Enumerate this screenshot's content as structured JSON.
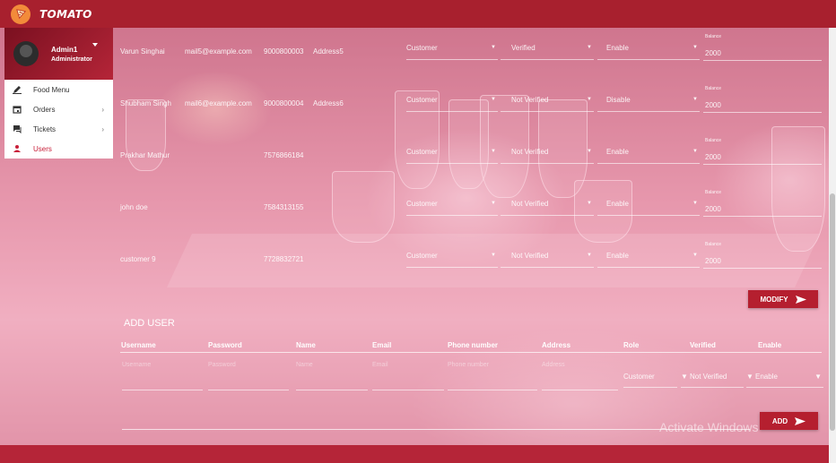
{
  "app": {
    "title": "TOMATO"
  },
  "profile": {
    "name": "Admin1",
    "role": "Administrator"
  },
  "menu": [
    {
      "label": "Food Menu",
      "icon": "pencil-icon",
      "has_chevron": false
    },
    {
      "label": "Orders",
      "icon": "calendar-icon",
      "has_chevron": true
    },
    {
      "label": "Tickets",
      "icon": "chat-icon",
      "has_chevron": true
    },
    {
      "label": "Users",
      "icon": "person-icon",
      "has_chevron": false
    }
  ],
  "users": [
    {
      "name": "Varun Singhai",
      "email": "mail5@example.com",
      "phone": "9000800003",
      "address": "Address5",
      "role": "Customer",
      "verified": "Verified",
      "enable": "Enable",
      "balance_label": "Balance",
      "balance": "2000"
    },
    {
      "name": "Shubham Singh",
      "email": "mail6@example.com",
      "phone": "9000800004",
      "address": "Address6",
      "role": "Customer",
      "verified": "Not Verified",
      "enable": "Disable",
      "balance_label": "Balance",
      "balance": "2000"
    },
    {
      "name": "Prakhar Mathur",
      "email": "",
      "phone": "7576866184",
      "address": "",
      "role": "Customer",
      "verified": "Not Verified",
      "enable": "Enable",
      "balance_label": "Balance",
      "balance": "2000"
    },
    {
      "name": "john doe",
      "email": "",
      "phone": "7584313155",
      "address": "",
      "role": "Customer",
      "verified": "Not Verified",
      "enable": "Enable",
      "balance_label": "Balance",
      "balance": "2000"
    },
    {
      "name": "customer 9",
      "email": "",
      "phone": "7728832721",
      "address": "",
      "role": "Customer",
      "verified": "Not Verified",
      "enable": "Enable",
      "balance_label": "Balance",
      "balance": "2000"
    }
  ],
  "modify_label": "MODIFY",
  "add_user": {
    "title": "ADD USER",
    "headers": [
      "Username",
      "Password",
      "Name",
      "Email",
      "Phone number",
      "Address",
      "Role",
      "Verified",
      "Enable"
    ],
    "placeholders": [
      "Username",
      "Password",
      "Name",
      "Email",
      "Phone number",
      "Address"
    ],
    "role": "Customer",
    "verified": "Not Verified",
    "enable": "Enable",
    "add_label": "ADD"
  },
  "watermark": "Activate Windows",
  "colors": {
    "topbar": "#a8202e",
    "accent": "#b51f2f",
    "users_active": "#c8203a"
  }
}
